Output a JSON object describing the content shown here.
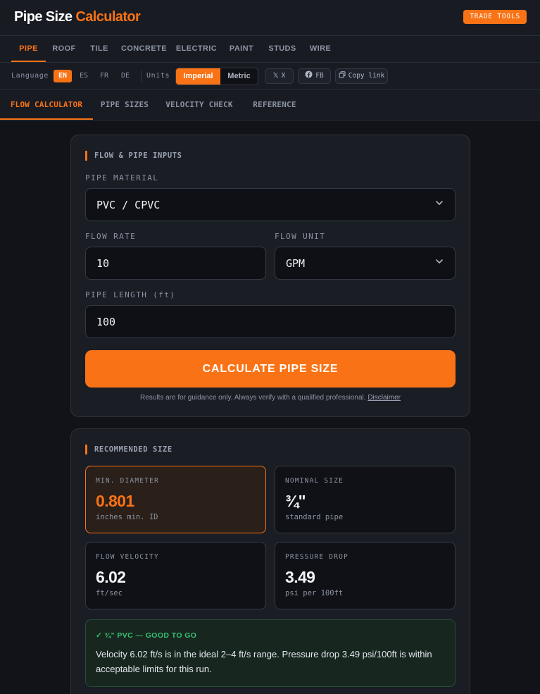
{
  "header": {
    "logo_main": "Pipe Size",
    "logo_accent": "Calculator",
    "badge": "TRADE TOOLS",
    "colors": {
      "accent": "#f97316",
      "background": "#111318"
    }
  },
  "categories": {
    "items": [
      "PIPE",
      "ROOF",
      "TILE",
      "CONCRETE",
      "ELECTRIC",
      "PAINT",
      "STUDS",
      "WIRE"
    ],
    "active": "PIPE"
  },
  "settings": {
    "language_label": "Language",
    "languages": [
      "EN",
      "ES",
      "FR",
      "DE"
    ],
    "active_language": "EN",
    "units_label": "Units",
    "units": [
      "Imperial",
      "Metric"
    ],
    "active_unit": "Imperial",
    "share": {
      "x": {
        "icon": "x-logo-icon",
        "label": "X"
      },
      "fb": {
        "icon": "facebook-icon",
        "label": "FB"
      },
      "copy": {
        "icon": "copy-icon",
        "label": "Copy link"
      }
    }
  },
  "tabs": {
    "items": [
      "FLOW CALCULATOR",
      "PIPE SIZES",
      "VELOCITY CHECK",
      "REFERENCE"
    ],
    "active": "FLOW CALCULATOR"
  },
  "inputs": {
    "title": "FLOW & PIPE INPUTS",
    "pipe_material": {
      "label": "PIPE MATERIAL",
      "value": "PVC / CPVC"
    },
    "flow_rate": {
      "label": "FLOW RATE",
      "value": "10"
    },
    "flow_unit": {
      "label": "FLOW UNIT",
      "value": "GPM"
    },
    "pipe_length": {
      "label": "PIPE LENGTH (ft)",
      "value": "100"
    },
    "calculate_label": "CALCULATE PIPE SIZE",
    "disclaimer_text": "Results are for guidance only. Always verify with a qualified professional.",
    "disclaimer_link": "Disclaimer"
  },
  "results": {
    "title": "RECOMMENDED SIZE",
    "min_diameter": {
      "label": "MIN. DIAMETER",
      "value": "0.801",
      "unit": "inches min. ID"
    },
    "nominal_size": {
      "label": "NOMINAL SIZE",
      "value": "¾\"",
      "unit": "standard pipe"
    },
    "flow_velocity": {
      "label": "FLOW VELOCITY",
      "value": "6.02",
      "unit": "ft/sec"
    },
    "pressure_drop": {
      "label": "PRESSURE DROP",
      "value": "3.49",
      "unit": "psi per 100ft"
    },
    "verdict": {
      "title": "✓ ¾\" PVC — GOOD TO GO",
      "body": "Velocity 6.02 ft/s is in the ideal 2–4 ft/s range. Pressure drop 3.49 psi/100ft is within acceptable limits for this run.",
      "color": "#38c172"
    }
  }
}
